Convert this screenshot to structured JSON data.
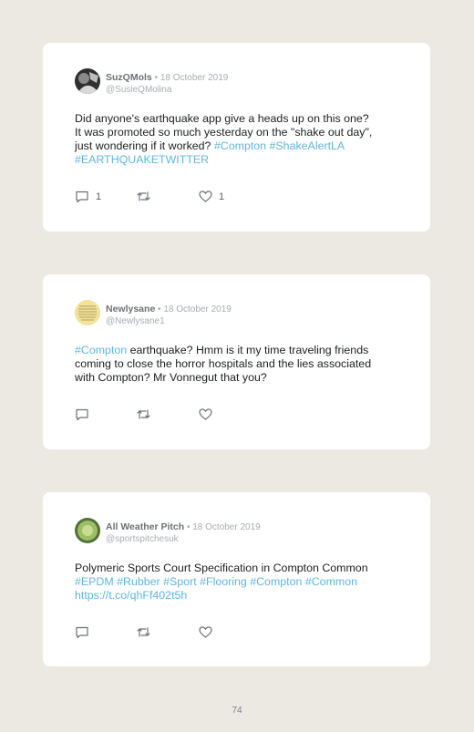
{
  "tweets": [
    {
      "name": "SuzQMols",
      "date": " • 18 October 2019",
      "handle": "@SusieQMolina",
      "text_parts": [
        "Did anyone's earthquake app give a heads up on this one?",
        "It was promoted so much yesterday on the \"shake out day\",",
        "just wondering if it worked? "
      ],
      "hashtags": [
        "#Compton",
        "#ShakeAlertLA",
        "#EARTHQUAKETWITTER"
      ],
      "reply_count": "1",
      "like_count": "1",
      "avatar_color": "#3a3a3a"
    },
    {
      "name": "Newlysane",
      "date": " • 18 October 2019",
      "handle": "@Newlysane1",
      "lead_tag": "#Compton",
      "text_parts": [
        " earthquake? Hmm is it my time traveling friends",
        "coming to close the horror hospitals and the lies associated",
        "with Compton? Mr Vonnegut that you?"
      ],
      "reply_count": "",
      "like_count": "",
      "avatar_color": "#F3E29A"
    },
    {
      "name": "All Weather Pitch",
      "date": " • 18 October 2019",
      "handle": "@sportspitchesuk",
      "text_parts": [
        "Polymeric Sports Court Specification in Compton Common"
      ],
      "hashtags": [
        "#EPDM",
        "#Rubber",
        "#Sport",
        "#Flooring",
        "#Compton",
        "#Common"
      ],
      "link": "https://t.co/qhFf402t5h",
      "reply_count": "",
      "like_count": "",
      "avatar_color": "#8DAF5A"
    }
  ],
  "page_number": "74",
  "colors": {
    "link": "#5FB6E0",
    "background": "#ECE9E3",
    "card": "#FFFFFF"
  },
  "icons": [
    "reply-icon",
    "retweet-icon",
    "like-icon"
  ]
}
